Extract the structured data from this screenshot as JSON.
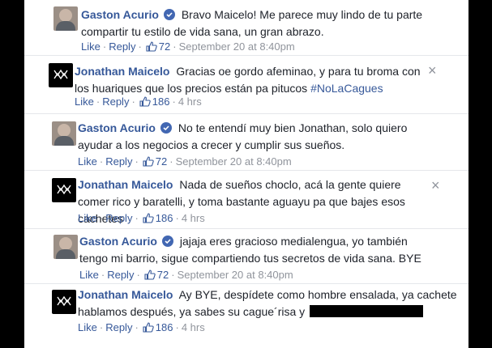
{
  "comments": [
    {
      "author": "Gaston Acurio",
      "verified": true,
      "text": "Bravo Maicelo! Me parece muy lindo de tu parte compartir tu estilo de vida sana, un gran abrazo.",
      "like": "Like",
      "reply": "Reply",
      "likes": "72",
      "time": "September 20 at 8:40pm"
    },
    {
      "author": "Jonathan Maicelo",
      "verified": false,
      "text": "Gracias oe gordo afeminao, y para tu broma con los huariques que los precios están pa pitucos",
      "hashtag": "#NoLaCagues",
      "like": "Like",
      "reply": "Reply",
      "likes": "186",
      "time": "4 hrs"
    },
    {
      "author": "Gaston Acurio",
      "verified": true,
      "text": "No te entendí muy bien Jonathan, solo quiero ayudar a los negocios a crecer y cumplir sus sueños.",
      "like": "Like",
      "reply": "Reply",
      "likes": "72",
      "time": "September 20 at 8:40pm"
    },
    {
      "author": "Jonathan Maicelo",
      "verified": false,
      "text": "Nada de sueños choclo, acá la gente quiere comer rico y baratelli, y toma bastante aguayu pa que bajes esos cachetes",
      "like": "Like",
      "reply": "Reply",
      "likes": "186",
      "time": "4 hrs"
    },
    {
      "author": "Gaston Acurio",
      "verified": true,
      "text": "jajaja eres gracioso medialengua, yo también tengo mi barrio, sigue compartiendo tus secretos de vida sana. BYE",
      "like": "Like",
      "reply": "Reply",
      "likes": "72",
      "time": "September 20 at 8:40pm"
    },
    {
      "author": "Jonathan Maicelo",
      "verified": false,
      "text": "Ay BYE, despídete como hombre ensalada, ya cachete hablamos después, ya sabes su cague´risa y",
      "like": "Like",
      "reply": "Reply",
      "likes": "186",
      "time": "4 hrs"
    }
  ],
  "close_glyph": "×",
  "colors": {
    "link": "#365899",
    "muted": "#90949c",
    "text": "#1d2129",
    "verified": "#4267b2"
  }
}
